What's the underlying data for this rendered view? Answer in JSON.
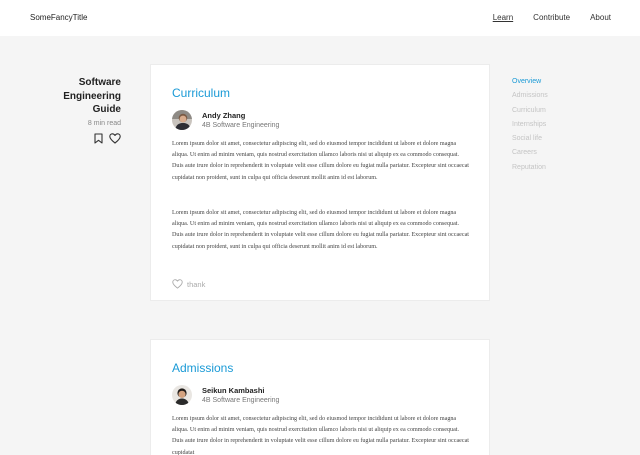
{
  "header": {
    "brand": "SomeFancyTitle",
    "nav": [
      {
        "label": "Learn",
        "active": true
      },
      {
        "label": "Contribute",
        "active": false
      },
      {
        "label": "About",
        "active": false
      }
    ]
  },
  "guide": {
    "title_lines": [
      "Software",
      "Engineering",
      "Guide"
    ],
    "read_time": "8 min read"
  },
  "sections": [
    {
      "title": "Curriculum",
      "author": {
        "name": "Andy Zhang",
        "role": "4B Software Engineering"
      },
      "paragraphs": [
        "Lorem ipsum dolor sit amet, consectetur adipiscing elit, sed do eiusmod tempor incididunt ut labore et dolore magna aliqua. Ut enim ad minim veniam, quis nostrud exercitation ullamco laboris nisi ut aliquip ex ea commodo consequat. Duis aute irure dolor in reprehenderit in voluptate velit esse cillum dolore eu fugiat nulla pariatur. Excepteur sint occaecat cupidatat non proident, sunt in culpa qui officia deserunt mollit anim id est laborum.",
        "Lorem ipsum dolor sit amet, consectetur adipiscing elit, sed do eiusmod tempor incididunt ut labore et dolore magna aliqua. Ut enim ad minim veniam, quis nostrud exercitation ullamco laboris nisi ut aliquip ex ea commodo consequat. Duis aute irure dolor in reprehenderit in voluptate velit esse cillum dolore eu fugiat nulla pariatur. Excepteur sint occaecat cupidatat non proident, sunt in culpa qui officia deserunt mollit anim id est laborum."
      ],
      "thank_label": "thank"
    },
    {
      "title": "Admissions",
      "author": {
        "name": "Seikun Kambashi",
        "role": "4B Software Engineering"
      },
      "paragraphs": [
        "Lorem ipsum dolor sit amet, consectetur adipiscing elit, sed do eiusmod tempor incididunt ut labore et dolore magna aliqua. Ut enim ad minim veniam, quis nostrud exercitation ullamco laboris nisi ut aliquip ex ea commodo consequat. Duis aute irure dolor in reprehenderit in voluptate velit esse cillum dolore eu fugiat nulla pariatur. Excepteur sint occaecat cupidatat"
      ]
    }
  ],
  "toc": [
    {
      "label": "Overview",
      "active": true
    },
    {
      "label": "Admissions",
      "active": false
    },
    {
      "label": "Curriculum",
      "active": false
    },
    {
      "label": "Internships",
      "active": false
    },
    {
      "label": "Social life",
      "active": false
    },
    {
      "label": "Careers",
      "active": false
    },
    {
      "label": "Reputation",
      "active": false
    }
  ],
  "icons": {
    "bookmark": "bookmark-icon",
    "heart": "heart-icon"
  },
  "colors": {
    "accent": "#1a9ad6",
    "page_bg": "#f5f5f5",
    "toc_inactive": "#c4c4c4"
  }
}
